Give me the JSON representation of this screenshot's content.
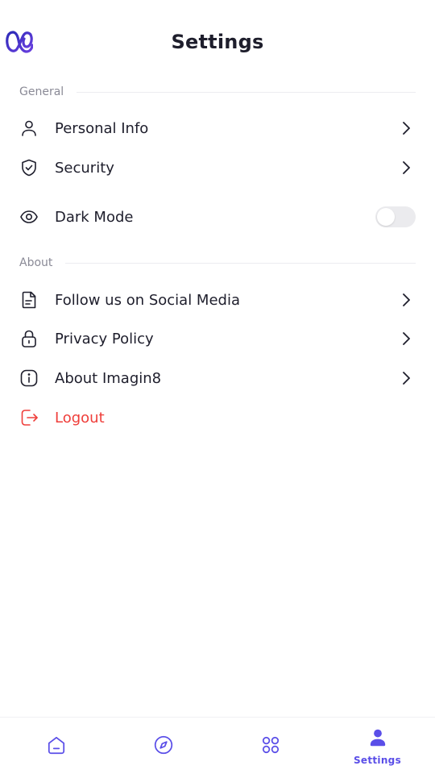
{
  "header": {
    "title": "Settings",
    "logo": "infinity-logo"
  },
  "sections": {
    "general": {
      "label": "General"
    },
    "about": {
      "label": "About"
    }
  },
  "general_items": {
    "personal_info": {
      "label": "Personal Info",
      "icon": "user-icon"
    },
    "security": {
      "label": "Security",
      "icon": "shield-check-icon"
    },
    "dark_mode": {
      "label": "Dark Mode",
      "icon": "eye-icon",
      "toggle_on": false
    }
  },
  "about_items": {
    "social": {
      "label": "Follow us on Social Media",
      "icon": "document-icon"
    },
    "privacy": {
      "label": "Privacy Policy",
      "icon": "lock-icon"
    },
    "about_app": {
      "label": "About Imagin8",
      "icon": "info-icon"
    }
  },
  "logout": {
    "label": "Logout",
    "icon": "logout-icon"
  },
  "bottom_nav": {
    "items": [
      {
        "icon": "home-icon",
        "label": "",
        "active": false
      },
      {
        "icon": "compass-icon",
        "label": "",
        "active": false
      },
      {
        "icon": "grid-icon",
        "label": "",
        "active": false
      },
      {
        "icon": "user-icon",
        "label": "Settings",
        "active": true
      }
    ]
  },
  "colors": {
    "accent": "#5a4ee8",
    "danger": "#ef3e3a",
    "text": "#1e1e2c",
    "muted": "#8a8a96",
    "toggle_off": "#ebebee"
  }
}
